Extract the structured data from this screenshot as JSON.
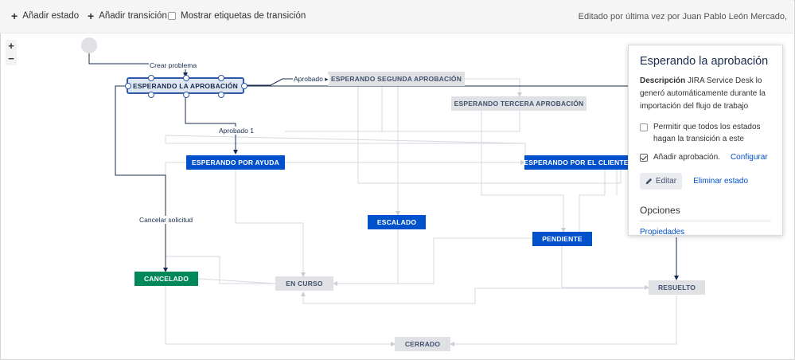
{
  "toolbar": {
    "add_state": "Añadir estado",
    "add_transition": "Añadir transición",
    "show_labels": "Mostrar etiquetas de transición",
    "edited_by": "Editado por última vez por Juan Pablo León Mercado,"
  },
  "zoom": {
    "in": "+",
    "out": "−"
  },
  "states": {
    "esperando_aprobacion": "ESPERANDO LA APROBACIÓN",
    "segunda": "ESPERANDO SEGUNDA APROBACIÓN",
    "tercera": "ESPERANDO TERCERA APROBACIÓN",
    "ayuda": "ESPERANDO POR AYUDA",
    "cliente": "ESPERANDO POR EL CLIENTE",
    "escalado": "ESCALADO",
    "pendiente": "PENDIENTE",
    "cancelado": "CANCELADO",
    "en_curso": "EN CURSO",
    "resuelto": "RESUELTO",
    "cerrado": "CERRADO"
  },
  "transitions": {
    "crear": "Crear problema",
    "aprobado": "Aprobado ▸",
    "aprobado1": "Aprobado 1",
    "cancelar": "Cancelar solicitud"
  },
  "panel": {
    "title": "Esperando la aprobación",
    "desc_label": "Descripción",
    "desc_text": "JIRA Service Desk lo generó automáticamente durante la importación del flujo de trabajo",
    "opt_allow": "Permitir que todos los estados hagan la transición a este",
    "opt_approval": "Añadir aprobación.",
    "configure": "Configurar",
    "edit": "Editar",
    "delete": "Eliminar estado",
    "options_heading": "Opciones",
    "properties": "Propiedades"
  },
  "colors": {
    "blue": "#0052cc",
    "green": "#00875a",
    "gray": "#dfe1e5",
    "selected_border": "#2f5aa8"
  }
}
